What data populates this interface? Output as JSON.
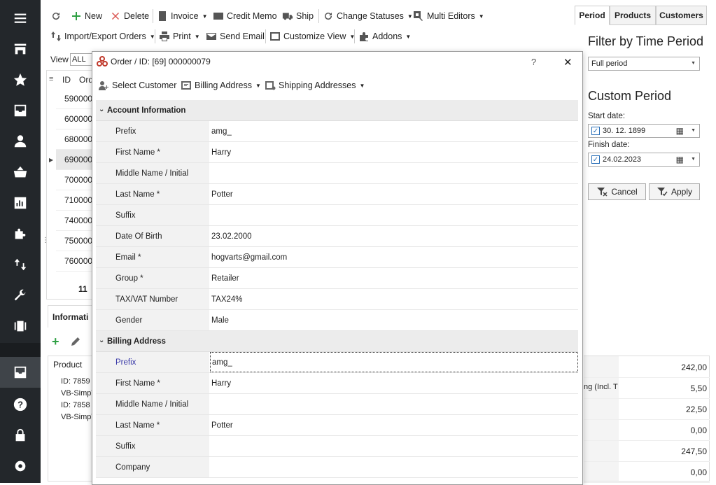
{
  "toolbar": {
    "row1": [
      "New",
      "Delete",
      "Invoice",
      "Credit Memo",
      "Ship",
      "Change Statuses",
      "Multi Editors"
    ],
    "row2": [
      "Import/Export Orders",
      "Print",
      "Send Email",
      "Customize View",
      "Addons"
    ]
  },
  "right_panel": {
    "tabs": [
      "Period",
      "Products",
      "Customers"
    ],
    "filter_title": "Filter by Time Period",
    "period_value": "Full period",
    "custom_title": "Custom Period",
    "start_label": "Start date:",
    "start_value": "30. 12. 1899",
    "finish_label": "Finish date:",
    "finish_value": "24.02.2023",
    "cancel_label": "Cancel",
    "apply_label": "Apply"
  },
  "grid": {
    "view_label": "View",
    "view_value": "ALL",
    "col_id": "ID",
    "col_ord": "Ord",
    "rows": [
      {
        "id": "59",
        "ord": "0000"
      },
      {
        "id": "60",
        "ord": "0000"
      },
      {
        "id": "68",
        "ord": "0000"
      },
      {
        "id": "69",
        "ord": "0000"
      },
      {
        "id": "70",
        "ord": "0000"
      },
      {
        "id": "71",
        "ord": "0000"
      },
      {
        "id": "74",
        "ord": "0000"
      },
      {
        "id": "75",
        "ord": "0000"
      },
      {
        "id": "76",
        "ord": "0000"
      }
    ],
    "total": "11"
  },
  "info": {
    "tab_label": "Informati",
    "product_header": "Product",
    "lines": [
      "ID: 7859",
      "VB-SimpT",
      "ID: 7858",
      "VB-SimpT"
    ]
  },
  "amounts": {
    "partial_label": "ng (Incl. T",
    "values": [
      "242,00",
      "5,50",
      "22,50",
      "0,00",
      "247,50",
      "0,00"
    ]
  },
  "modal": {
    "title": "Order / ID: [69] 000000079",
    "help": "?",
    "close": "✕",
    "toolbar": [
      "Select Customer",
      "Billing Address",
      "Shipping Addresses"
    ],
    "account_section": "Account Information",
    "account_fields": [
      {
        "label": "Prefix",
        "value": "amg_"
      },
      {
        "label": "First Name *",
        "value": "Harry"
      },
      {
        "label": "Middle Name / Initial",
        "value": ""
      },
      {
        "label": "Last Name *",
        "value": "Potter"
      },
      {
        "label": "Suffix",
        "value": ""
      },
      {
        "label": "Date Of Birth",
        "value": "23.02.2000"
      },
      {
        "label": "Email *",
        "value": "hogvarts@gmail.com"
      },
      {
        "label": "Group *",
        "value": "Retailer"
      },
      {
        "label": "TAX/VAT Number",
        "value": "TAX24%"
      },
      {
        "label": "Gender",
        "value": "Male"
      }
    ],
    "billing_section": "Billing Address",
    "billing_fields": [
      {
        "label": "Prefix",
        "value": "amg_"
      },
      {
        "label": "First Name *",
        "value": "Harry"
      },
      {
        "label": "Middle Name / Initial",
        "value": ""
      },
      {
        "label": "Last Name *",
        "value": "Potter"
      },
      {
        "label": "Suffix",
        "value": ""
      },
      {
        "label": "Company",
        "value": ""
      }
    ]
  },
  "colors": {
    "sidebar": "#23272b",
    "accent_green": "#2ea043",
    "delete_red": "#d9534f",
    "selected_label": "#3a3aa8"
  }
}
